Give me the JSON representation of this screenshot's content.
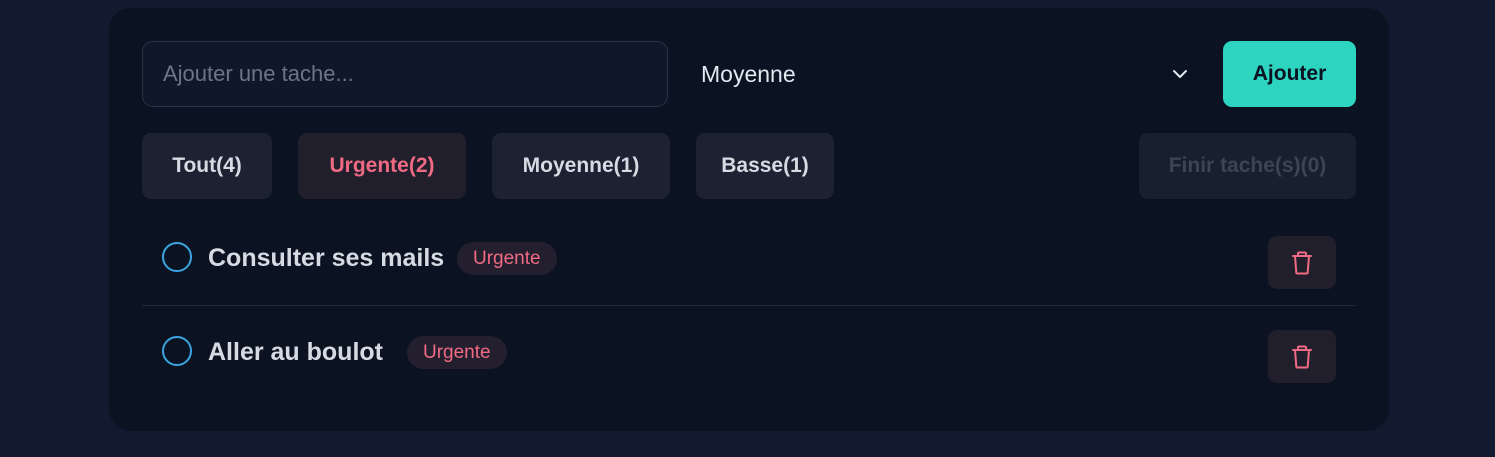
{
  "form": {
    "input_placeholder": "Ajouter une tache...",
    "input_value": "",
    "priority_selected": "Moyenne",
    "add_label": "Ajouter"
  },
  "filters": {
    "all_label": "Tout(4)",
    "urgent_label": "Urgente(2)",
    "medium_label": "Moyenne(1)",
    "low_label": "Basse(1)",
    "finish_label": "Finir tache(s)(0)",
    "active": "Urgente"
  },
  "tasks": [
    {
      "title": "Consulter ses mails",
      "priority": "Urgente",
      "done": false
    },
    {
      "title": "Aller au boulot",
      "priority": "Urgente",
      "done": false
    }
  ],
  "icons": {
    "dropdown": "chevron-down-icon",
    "delete": "trash-icon",
    "toggle": "circle-checkbox-icon"
  },
  "colors": {
    "accent": "#2dd4bf",
    "urgent": "#f16a83",
    "checkbox": "#3aa5e0",
    "background": "#111a2e",
    "card": "#0b1222"
  }
}
